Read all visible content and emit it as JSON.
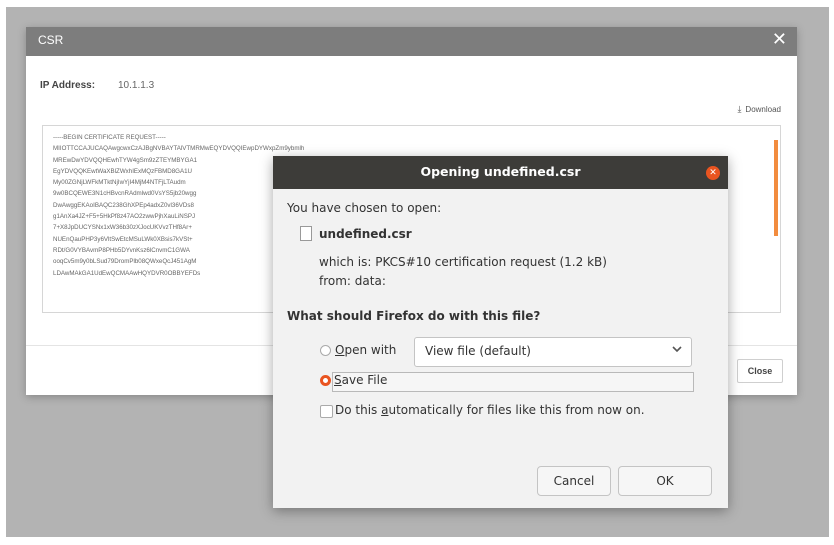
{
  "csr_modal": {
    "title": "CSR",
    "close_icon": "✕",
    "ip_label": "IP Address:",
    "ip_value": "10.1.1.3",
    "download_label": "Download",
    "cert_lines": [
      "-----BEGIN CERTIFICATE REQUEST-----",
      "MIIOTTCCAJUCAQAwgcwxCzAJBgNVBAYTAlVTMRMwEQYDVQQIEwpDYWxpZm9ybmlh",
      "MREwDwYDVQQHEwhTYW4gSm9zZTEYMBYGA1",
      "EgYDVQQKEwtWaXBlZWxhIExMQzFBMD8GA1U",
      "My00ZGNjLWFkMTktNjIwYjI4MjM4NTFjLTAudm",
      "9w0BCQEWE3N1cHBvcnRAdmlwd0VsYS5jb20wgg",
      "DwAwggEKAoIBAQC238GhXPEp4adxZ0vl36VDs8",
      "g1AnXa4JZ+F5+5HkPf8z47AO2zwwPjhXauLiNSPJ",
      "7+X8JpDUCYSNx1xW36b30zXJocUKVvzTHf8Ar+",
      "NUEnQauPHP3y6VltSwEtcMSuLWk0XBsis7kVSt+",
      "RDt/G0VYBAvmP8PHb5DYvnKsz6lCnvmC1GWA",
      "ooqCv5m9y0bLSud79DromPlb08QWxeQcJ451AgM",
      "LDAwMAkGA1UdEwQCMAAwHQYDVR0OBBYEFDs"
    ],
    "close_button": "Close"
  },
  "firefox_dialog": {
    "title": "Opening undefined.csr",
    "close_icon": "✕",
    "intro": "You have chosen to open:",
    "file_name": "undefined.csr",
    "which_is": "which is: PKCS#10 certification request (1.2 kB)",
    "from": "from: data:",
    "question": "What should Firefox do with this file?",
    "open_with": {
      "mnemonic": "O",
      "rest": "pen with",
      "selected": false
    },
    "open_with_select": {
      "value": "View file (default)",
      "chevron_icon": "chevron-down-icon"
    },
    "save_file": {
      "mnemonic": "S",
      "rest": "ave File",
      "selected": true
    },
    "auto": {
      "before": "Do this ",
      "mnemonic": "a",
      "rest": "utomatically for files like this from now on.",
      "checked": false
    },
    "cancel": "Cancel",
    "ok": "OK"
  },
  "colors": {
    "accent": "#e95420",
    "titlebar": "#3d3c39",
    "csr_titlebar": "#7d7d7d",
    "scroll_accent": "#f28c3e"
  }
}
